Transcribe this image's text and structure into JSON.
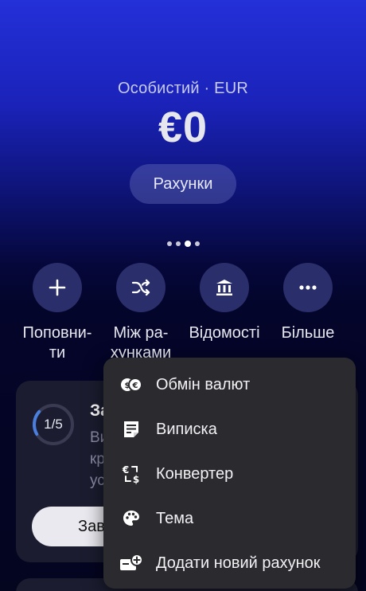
{
  "header": {
    "account_label": "Особистий · EUR",
    "balance": "€0",
    "accounts_button": "Рахунки"
  },
  "pager": {
    "count": 4,
    "active_index": 2
  },
  "actions": [
    {
      "icon": "plus-icon",
      "label_line1": "Поповни-",
      "label_line2": "ти"
    },
    {
      "icon": "shuffle-icon",
      "label_line1": "Між ра-",
      "label_line2": "хунками"
    },
    {
      "icon": "bank-icon",
      "label_line1": "Відомості",
      "label_line2": ""
    },
    {
      "icon": "more-icon",
      "label_line1": "Більше",
      "label_line2": ""
    }
  ],
  "card": {
    "progress_text": "1/5",
    "progress_value": 0.2,
    "title": "За",
    "desc_lines": [
      "Ви",
      "кр",
      "ус"
    ],
    "cta_label": "Зав"
  },
  "menu": {
    "items": [
      {
        "icon": "currency-exchange-icon",
        "label": "Обмін валют"
      },
      {
        "icon": "statement-icon",
        "label": "Виписка"
      },
      {
        "icon": "converter-icon",
        "label": "Конвертер"
      },
      {
        "icon": "palette-icon",
        "label": "Тема"
      },
      {
        "icon": "add-account-icon",
        "label": "Додати новий рахунок"
      }
    ]
  },
  "colors": {
    "accent_blue": "#2430d8",
    "action_circle": "#2a2e6a",
    "menu_bg": "#2b2b2f",
    "card_bg": "#1b1c2f",
    "progress_arc": "#4a7fe0"
  }
}
